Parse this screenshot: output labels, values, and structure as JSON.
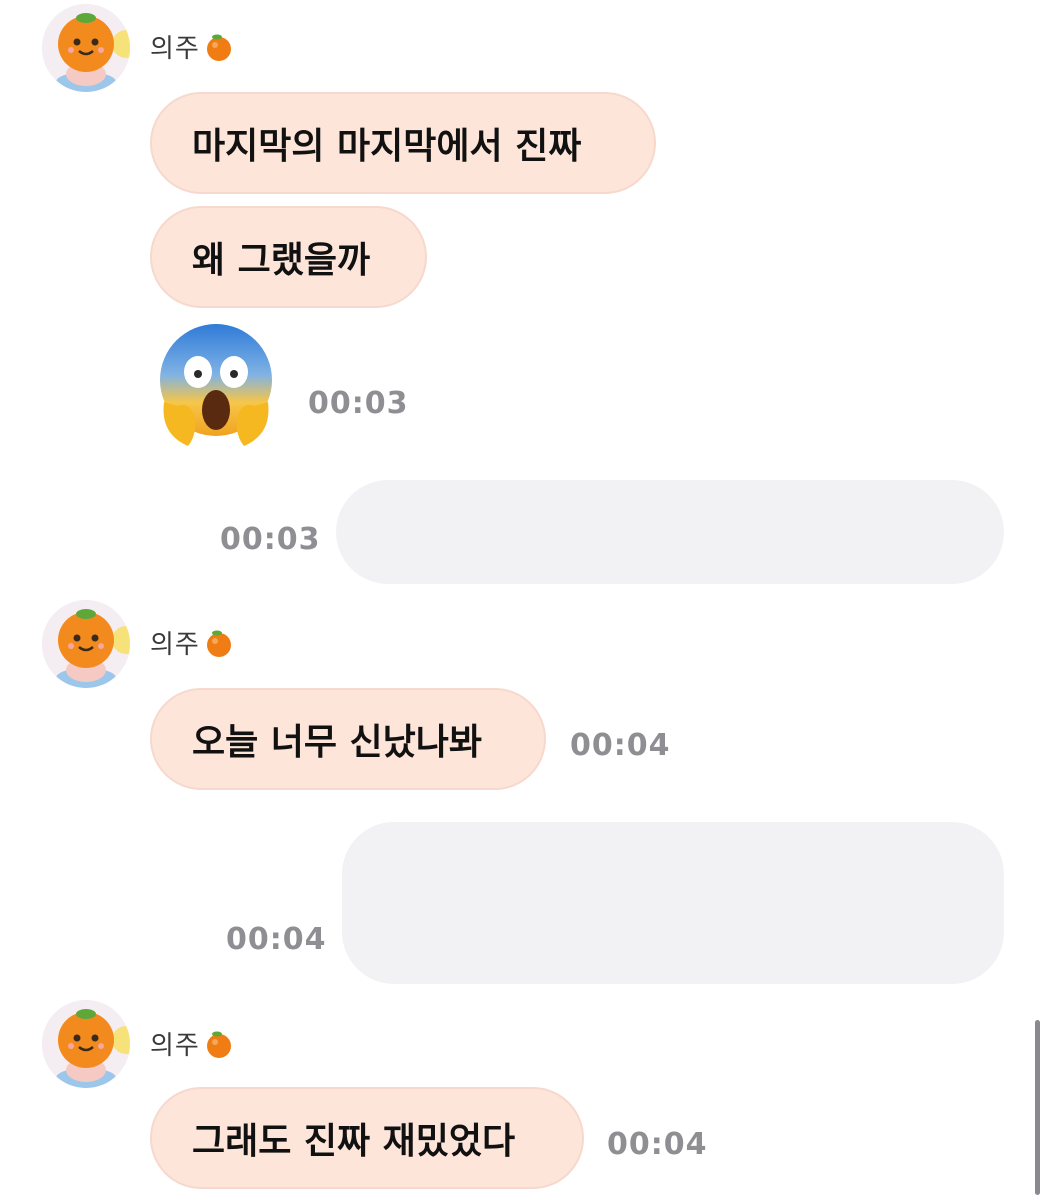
{
  "messages": [
    {
      "sender": "의주",
      "bubbles": [
        "마지막의 마지막에서 진짜",
        "왜 그랬을까"
      ],
      "emoji": "screaming-face",
      "time": "00:03"
    },
    {
      "outgoing": true,
      "time": "00:03"
    },
    {
      "sender": "의주",
      "bubbles": [
        "오늘 너무 신났나봐"
      ],
      "time": "00:04"
    },
    {
      "outgoing": true,
      "time": "00:04"
    },
    {
      "sender": "의주",
      "bubbles": [
        "그래도 진짜 재밌었다"
      ],
      "time": "00:04"
    }
  ],
  "colors": {
    "incoming_bubble": "#fde5da",
    "outgoing_bubble": "#f2f2f5",
    "time_text": "#8e8e93"
  },
  "icons": {
    "avatar": "orange-character-avatar",
    "sender_suffix": "orange-emoji",
    "sticker": "screaming-face-emoji"
  }
}
